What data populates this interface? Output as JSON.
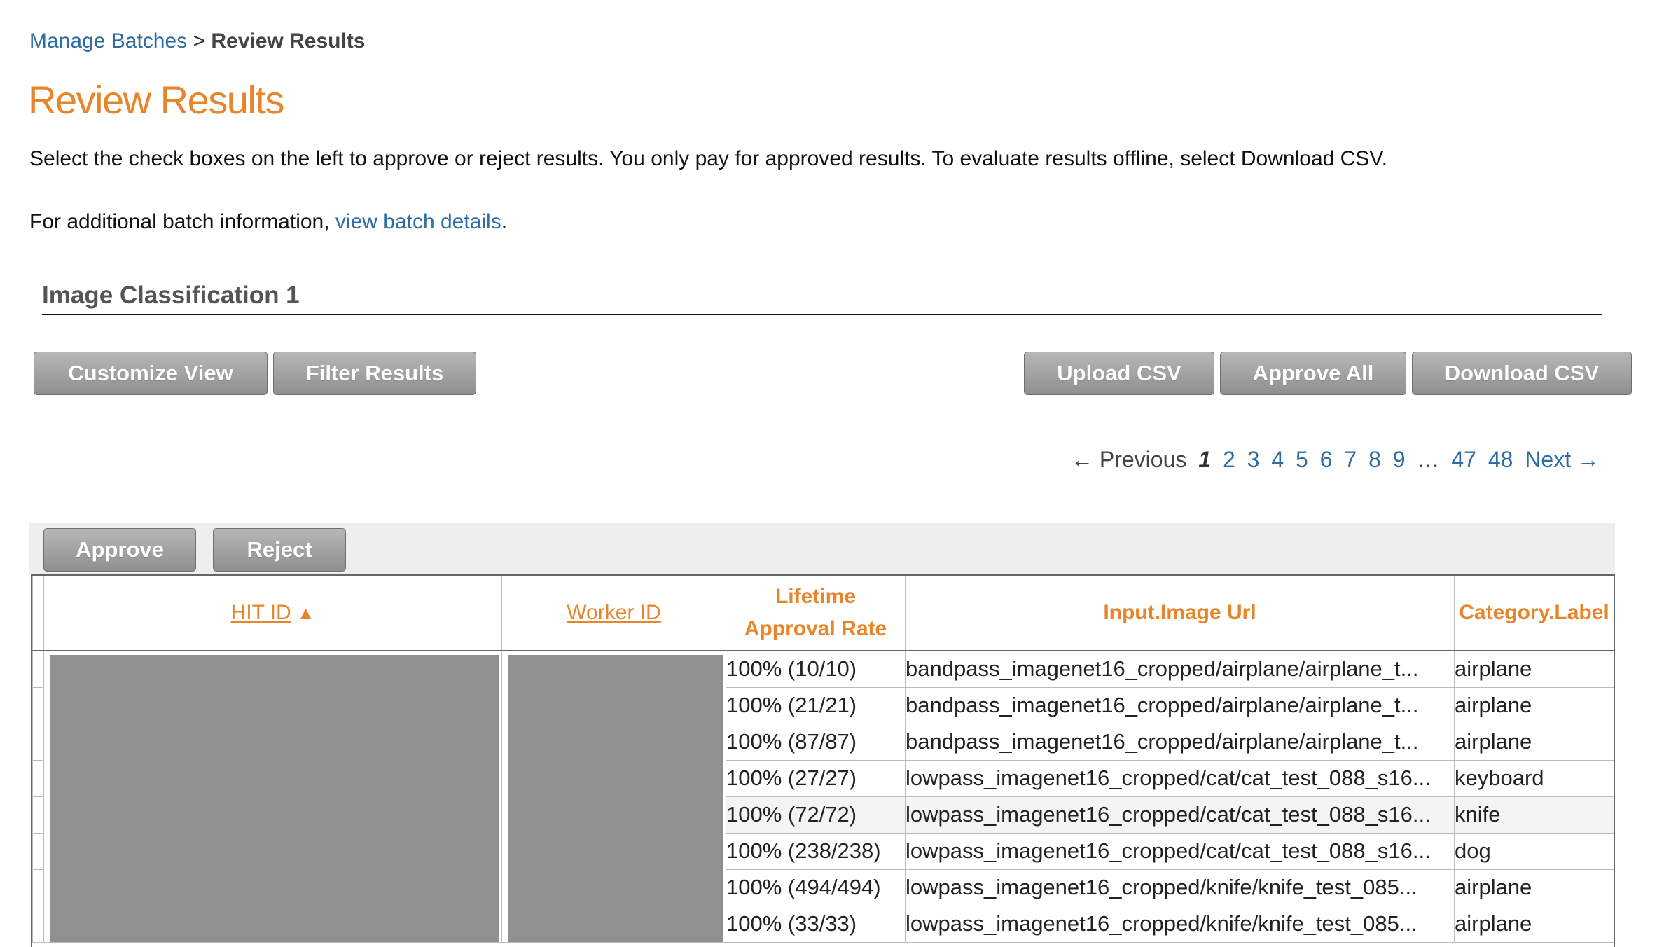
{
  "breadcrumb": {
    "parent": "Manage Batches",
    "separator": ">",
    "current": "Review Results"
  },
  "page_title": "Review Results",
  "description": {
    "line1": "Select the check boxes on the left to approve or reject results. You only pay for approved results. To evaluate results offline, select Download CSV.",
    "line2_prefix": "For additional batch information, ",
    "line2_link": "view batch details",
    "line2_suffix": "."
  },
  "section_title": "Image Classification 1",
  "toolbar": {
    "customize_view": "Customize View",
    "filter_results": "Filter Results",
    "upload_csv": "Upload CSV",
    "approve_all": "Approve All",
    "download_csv": "Download CSV"
  },
  "pagination": {
    "previous": "← Previous",
    "current": "1",
    "pages": [
      "2",
      "3",
      "4",
      "5",
      "6",
      "7",
      "8",
      "9"
    ],
    "ellipsis": "…",
    "last_pages": [
      "47",
      "48"
    ],
    "next": "Next →"
  },
  "actions": {
    "approve": "Approve",
    "reject": "Reject"
  },
  "table": {
    "columns": {
      "hit_id": "HIT ID",
      "sort_indicator": "▲",
      "worker_id": "Worker ID",
      "approval_rate_line1": "Lifetime",
      "approval_rate_line2": "Approval Rate",
      "image_url": "Input.Image Url",
      "category": "Category.Label"
    },
    "rows": [
      {
        "rate": "100% (10/10)",
        "url": "bandpass_imagenet16_cropped/airplane/airplane_t...",
        "category": "airplane"
      },
      {
        "rate": "100% (21/21)",
        "url": "bandpass_imagenet16_cropped/airplane/airplane_t...",
        "category": "airplane"
      },
      {
        "rate": "100% (87/87)",
        "url": "bandpass_imagenet16_cropped/airplane/airplane_t...",
        "category": "airplane"
      },
      {
        "rate": "100% (27/27)",
        "url": "lowpass_imagenet16_cropped/cat/cat_test_088_s16...",
        "category": "keyboard"
      },
      {
        "rate": "100% (72/72)",
        "url": "lowpass_imagenet16_cropped/cat/cat_test_088_s16...",
        "category": "knife"
      },
      {
        "rate": "100% (238/238)",
        "url": "lowpass_imagenet16_cropped/cat/cat_test_088_s16...",
        "category": "dog"
      },
      {
        "rate": "100% (494/494)",
        "url": "lowpass_imagenet16_cropped/knife/knife_test_085...",
        "category": "airplane"
      },
      {
        "rate": "100% (33/33)",
        "url": "lowpass_imagenet16_cropped/knife/knife_test_085...",
        "category": "airplane"
      }
    ]
  },
  "colors": {
    "accent": "#e8852a",
    "link": "#2e6da4",
    "button": "#9a9a9a",
    "redaction": "#909090"
  }
}
